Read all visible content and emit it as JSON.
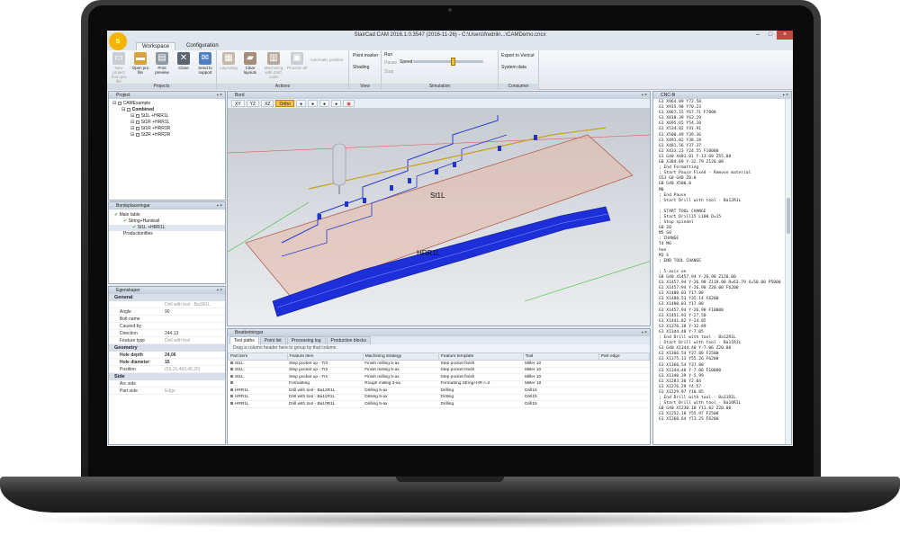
{
  "window": {
    "title": "StairCad CAM 2016.1.0.3547 (2016-11-26) - C:\\Users\\fredrik\\...\\CAMDemo.cncx",
    "logo": "S"
  },
  "ribbon_tabs": [
    "Workspace",
    "Configuration"
  ],
  "ribbon": {
    "projects": {
      "label": "Projects",
      "buttons": [
        "New project from pro file",
        "Open pro file",
        "Print preview",
        "Close",
        "Send to support"
      ]
    },
    "actions": {
      "label": "Actions",
      "buttons": [
        "Layouting",
        "Clear layouts",
        "Machining with CNC code",
        "Process all",
        "Automatic position"
      ]
    },
    "view": {
      "label": "View",
      "items": [
        "Point marker",
        "Shading"
      ]
    },
    "simulation": {
      "label": "Simulation",
      "items": [
        "Run",
        "Pause",
        "Stop"
      ],
      "speed_label": "Speed"
    },
    "consumer": {
      "label": "Consumer",
      "items": [
        "Export to Vericut",
        "System data"
      ]
    }
  },
  "project_panel": {
    "title": "Project",
    "tree": [
      {
        "label": "CAMExample",
        "level": 0
      },
      {
        "label": "Combined",
        "level": 1
      },
      {
        "label": "St1L +HRR1L",
        "level": 2
      },
      {
        "label": "St1R +HRR1L",
        "level": 2
      },
      {
        "label": "St1R +HRR1R",
        "level": 2
      },
      {
        "label": "St2R +HRR2R",
        "level": 2
      }
    ]
  },
  "board_panel": {
    "title": "Bordsplaceringar",
    "tree": [
      {
        "label": "Main table",
        "level": 0
      },
      {
        "label": "String+Handrail",
        "level": 1
      },
      {
        "label": "St1L +HRR1L",
        "level": 2
      },
      {
        "label": "Productionfiles",
        "level": 1
      }
    ]
  },
  "properties_panel": {
    "title": "Egenskaper",
    "categories": [
      {
        "name": "General",
        "rows": [
          {
            "key": "",
            "value": "Drill with tool - Ba1R1L",
            "muted": true
          },
          {
            "key": "Angle",
            "value": "90"
          },
          {
            "key": "Bolt name",
            "value": ""
          },
          {
            "key": "Caused by",
            "value": "",
            "muted": true
          },
          {
            "key": "Direction",
            "value": "244,13"
          },
          {
            "key": "Feature type",
            "value": "Drill with tool",
            "muted": true
          }
        ]
      },
      {
        "name": "Geometry",
        "rows": [
          {
            "key": "Hole depth",
            "value": "24,06",
            "bold": true
          },
          {
            "key": "Hole diameter",
            "value": "15",
            "bold": true
          },
          {
            "key": "Position",
            "value": "(59,15,450,45,20)",
            "muted": true
          }
        ]
      },
      {
        "name": "Side",
        "rows": [
          {
            "key": "Arc side",
            "value": "",
            "muted": true
          },
          {
            "key": "Part side",
            "value": "Edge",
            "muted": true
          }
        ]
      }
    ]
  },
  "view_panel": {
    "title": "Bord",
    "buttons": [
      "XY",
      "YZ",
      "XZ",
      "Ortho"
    ],
    "active": "Ortho",
    "labels": [
      "St1L",
      "HRR1L"
    ]
  },
  "work_panel": {
    "title": "Bearbetningar",
    "tabs": [
      "Tool paths",
      "Point list",
      "Processing log",
      "Production blocks"
    ],
    "active_tab": "Tool paths",
    "group_hint": "Drag a column header here to group by that column",
    "columns": [
      "Part item",
      "Feature item",
      "Machining strategy",
      "Feature template",
      "Tool",
      "Part edge"
    ],
    "rows": [
      [
        "St1L",
        "Step pocket up - Tr3",
        "Finish milling 5-ax",
        "Step pocket finish",
        "Miller 10",
        ""
      ],
      [
        "St1L",
        "Step pocket up - Tr2",
        "Finish milling 5-ax",
        "Step pocket finish",
        "Miller 10",
        ""
      ],
      [
        "St1L",
        "Step pocket up - Tr1",
        "Finish milling 5-ax",
        "Step pocket finish",
        "Miller 10",
        ""
      ],
      [
        "",
        "Formatting",
        "Rough milling 3-ax",
        "Formatting String+HR r=2",
        "Miller 18",
        ""
      ],
      [
        "HRR1L",
        "Drill with tool - Ba12R1L",
        "Drilling 5-ax",
        "Drilling",
        "Drill15",
        ""
      ],
      [
        "HRR1L",
        "Drill with tool - Ba11R1L",
        "Drilling 5-ax",
        "Drilling",
        "Drill15",
        ""
      ],
      [
        "HRR1L",
        "Drill with tool - Ba10R1L",
        "Drilling 5-ax",
        "Drilling",
        "Drill15",
        ""
      ]
    ]
  },
  "cnc_panel": {
    "title": "CNC-fil",
    "lines": [
      "G1 X964.09 Y72.58",
      "G1 X915.90 Y70.23",
      "G1 X867.15 Y67.71 F7800",
      "G1 X818.39 Y63.29",
      "G1 X695.65 Y54.10",
      "G1 X534.82 Y41.91",
      "G1 X500.49 Y39.36",
      "G1 X491.02 Y38.18",
      "G1 X481.56 Y37.37",
      "G1 X433.23 Y24.55 F10000",
      "G1 G40 X401.01 Y-13.68 Z55.00",
      "G0 X384.69 Y-32.79 Z120.00",
      "; End Formatting",
      "; Start Pause Fixed - Remove material",
      "G53 G0 G40 Z0.0",
      "G0 G40 X500.0",
      "M0",
      "; End Pause",
      "; Start Drill with tool - Ba12R1L",
      "",
      "; START TOOL CHANGE",
      "; Start Drill15 L100 D=15",
      "; Stop spindel",
      "G0 Z0",
      "M5 S0",
      "; CHANGE",
      "T4 M6",
      "hoe",
      "M3 S",
      "; END TOOL CHANGE",
      "",
      "; 5-axis on",
      "G0 G40 X1457.94 Y-26.98 Z120.00",
      "G1 X1457.94 Y-26.98 Z119.00 R=63.79 X=50.00 P5000",
      "G1 X1457.94 Y-26.98 Z20.00 F6200",
      "G1 X1480.03 Y17.88",
      "G1 X1488.53 Y35.14 F6200",
      "G1 X1480.03 Y17.88",
      "G1 X1457.94 Y-26.98 F10000",
      "G1 X1451.93 Y-27.50",
      "G1 X1441.82 Y-24.05",
      "G1 X1376.38 Y-12.89",
      "G1 X1344.40 Y-7.05",
      "; End Drill with tool - Ba12R1L",
      "; Start Drill with tool - Ba11R1L",
      "G1 G40 X1344.40 Y-7.06 Z20.00",
      "G1 X1366.54 Y37.80 F2500",
      "G1 X1375.13 Y55.26 F6200",
      "G1 X1366.54 Y37.80",
      "G1 X1344.40 Y-7.06 F10000",
      "G1 X1340.39 Y-5.99",
      "G1 X1283.30 Y2.04",
      "G1 X1276.29 Y4.57",
      "G1 X1229.97 Y10.85",
      "; End Drill with tool - Ba11R1L",
      "; Start Drill with tool - Ba10R1L",
      "G0 G40 X1230.10 Y11.02 Z20.00",
      "G1 X1252.18 Y55.97 F2500",
      "G1 X1260.64 Y73.25 F6200"
    ]
  }
}
